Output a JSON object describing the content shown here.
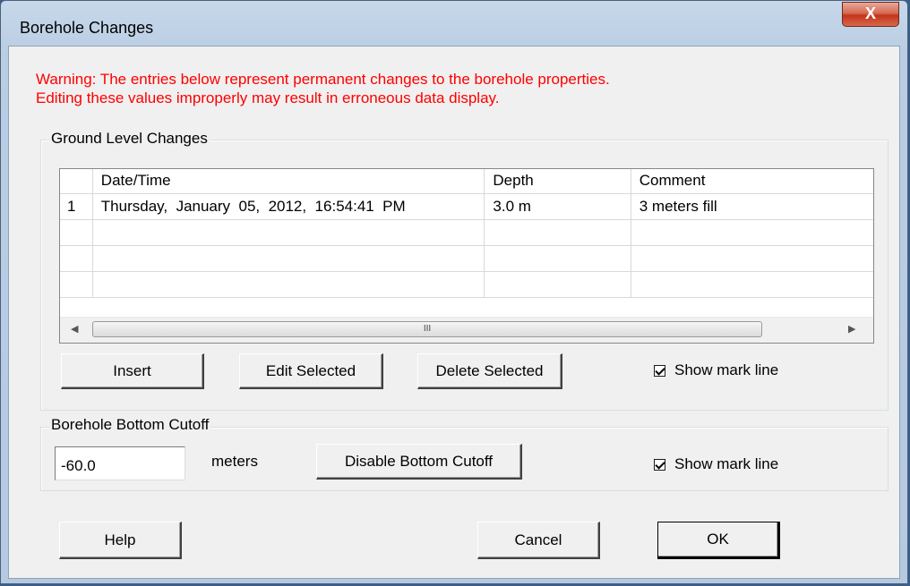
{
  "window": {
    "title": "Borehole Changes",
    "close_label": "X"
  },
  "warning": {
    "line1": "Warning: The entries below represent permanent changes to the borehole properties.",
    "line2": "Editing these values improperly may result in erroneous data display."
  },
  "ground_level": {
    "group_label": "Ground Level Changes",
    "columns": [
      "Date/Time",
      "Depth",
      "Comment"
    ],
    "rows": [
      {
        "num": "1",
        "datetime": "Thursday,  January  05,  2012,  16:54:41  PM",
        "depth": "3.0 m",
        "comment": "3 meters fill"
      }
    ],
    "scroll_thumb": "III",
    "insert_label": "Insert",
    "edit_label": "Edit Selected",
    "delete_label": "Delete Selected",
    "show_mark_line_label": "Show mark line",
    "show_mark_line_checked": true
  },
  "bottom_cutoff": {
    "group_label": "Borehole Bottom Cutoff",
    "value": "-60.0",
    "unit": "meters",
    "disable_label": "Disable Bottom Cutoff",
    "show_mark_line_label": "Show mark line",
    "show_mark_line_checked": true
  },
  "footer": {
    "help_label": "Help",
    "cancel_label": "Cancel",
    "ok_label": "OK"
  },
  "colors": {
    "warning": "#ff0000",
    "close_button": "#c2351b"
  }
}
